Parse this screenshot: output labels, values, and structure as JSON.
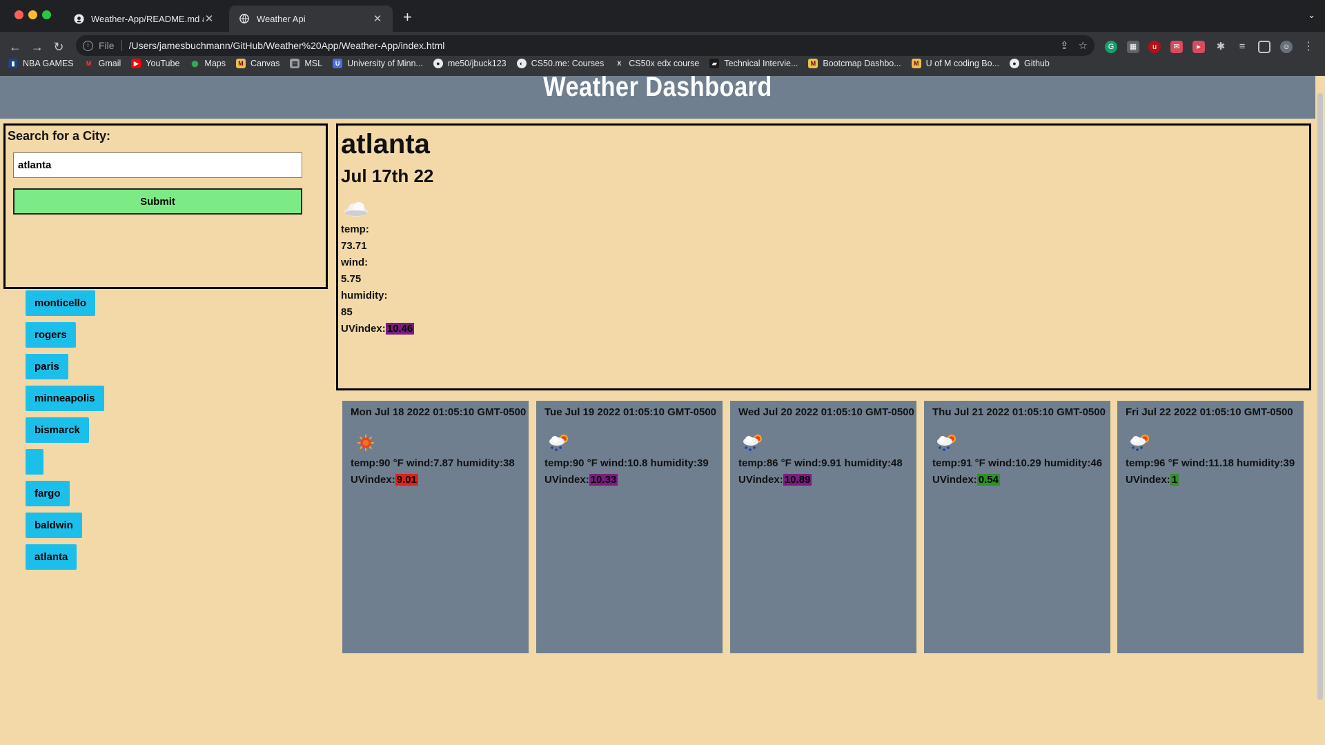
{
  "browser": {
    "tabs": [
      {
        "title": "Weather-App/README.md at m",
        "icon": "github-icon",
        "active": false
      },
      {
        "title": "Weather Api",
        "icon": "globe-icon",
        "active": true
      }
    ],
    "address": {
      "scheme_label": "File",
      "url": "/Users/jamesbuchmann/GitHub/Weather%20App/Weather-App/index.html"
    },
    "bookmarks": [
      {
        "label": "NBA GAMES",
        "icon": "nba-icon"
      },
      {
        "label": "Gmail",
        "icon": "gmail-icon"
      },
      {
        "label": "YouTube",
        "icon": "youtube-icon"
      },
      {
        "label": "Maps",
        "icon": "maps-icon"
      },
      {
        "label": "Canvas",
        "icon": "canvas-icon"
      },
      {
        "label": "MSL",
        "icon": "msl-icon"
      },
      {
        "label": "University of Minn...",
        "icon": "umn-icon"
      },
      {
        "label": "me50/jbuck123",
        "icon": "github-icon"
      },
      {
        "label": "CS50.me: Courses",
        "icon": "cs50-icon"
      },
      {
        "label": "CS50x edx course",
        "icon": "edx-icon"
      },
      {
        "label": "Technical Intervie...",
        "icon": "book-icon"
      },
      {
        "label": "Bootcmap Dashbo...",
        "icon": "bootcamp-icon"
      },
      {
        "label": "U of M coding Bo...",
        "icon": "umn-icon"
      },
      {
        "label": "Github",
        "icon": "github-icon"
      }
    ]
  },
  "page": {
    "title": "Weather Dashboard",
    "search": {
      "label": "Search for a City:",
      "value": "atlanta",
      "submit_label": "Submit"
    },
    "history": [
      "monticello",
      "rogers",
      "paris",
      "minneapolis",
      "bismarck",
      "",
      "fargo",
      "baldwin",
      "atlanta"
    ],
    "current": {
      "city": "atlanta",
      "date": "Jul 17th 22",
      "icon": "cloud-icon",
      "temp_label": "temp:",
      "temp": "73.71",
      "wind_label": "wind:",
      "wind": "5.75",
      "humidity_label": "humidity:",
      "humidity": "85",
      "uv_label": "UVindex:",
      "uv": "10.46",
      "uv_color": "#7a1d7e"
    },
    "forecast": [
      {
        "date": "Mon Jul 18 2022 01:05:10 GMT-0500",
        "icon": "sun-icon",
        "summary": "temp:90 °F wind:7.87 humidity:38",
        "uv_label": "UVindex:",
        "uv": "9.01",
        "uv_color": "#e0201e"
      },
      {
        "date": "Tue Jul 19 2022 01:05:10 GMT-0500",
        "icon": "rain-sun-icon",
        "summary": "temp:90 °F wind:10.8 humidity:39",
        "uv_label": "UVindex:",
        "uv": "10.33",
        "uv_color": "#7a1d7e"
      },
      {
        "date": "Wed Jul 20 2022 01:05:10 GMT-0500",
        "icon": "rain-sun-icon",
        "summary": "temp:86 °F wind:9.91 humidity:48",
        "uv_label": "UVindex:",
        "uv": "10.89",
        "uv_color": "#7a1d7e"
      },
      {
        "date": "Thu Jul 21 2022 01:05:10 GMT-0500",
        "icon": "rain-sun-icon",
        "summary": "temp:91 °F wind:10.29 humidity:46",
        "uv_label": "UVindex:",
        "uv": "0.54",
        "uv_color": "#2f8f2a"
      },
      {
        "date": "Fri Jul 22 2022 01:05:10 GMT-0500",
        "icon": "rain-sun-icon",
        "summary": "temp:96 °F wind:11.18 humidity:39",
        "uv_label": "UVindex:",
        "uv": "1",
        "uv_color": "#2f8f2a"
      }
    ]
  }
}
